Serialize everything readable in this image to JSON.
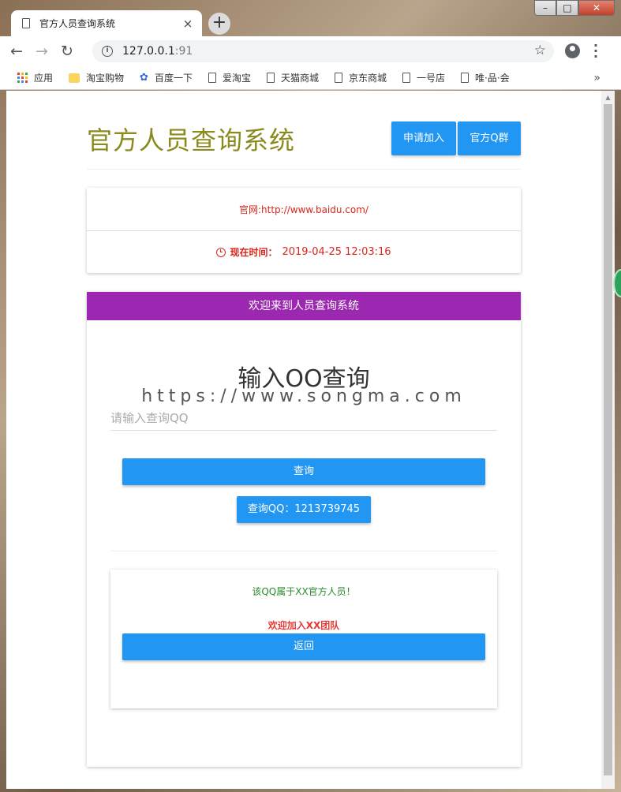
{
  "browser": {
    "tab_title": "官方人员查询系统",
    "tab_close": "×",
    "new_tab": "+",
    "url_host": "127.0.0.1",
    "url_port": ":91",
    "bookmarks": [
      "应用",
      "淘宝购物",
      "百度一下",
      "爱淘宝",
      "天猫商城",
      "京东商城",
      "一号店",
      "唯·品·会"
    ],
    "bookmarks_more": "»"
  },
  "header": {
    "site_title": "官方人员查询系统",
    "join_button": "申请加入",
    "qgroup_button": "官方Q群"
  },
  "info": {
    "website": "官网:http://www.baidu.com/",
    "time_label": "现在时间：",
    "time_value": "2019-04-25 12:03:16"
  },
  "panel": {
    "heading": "欢迎来到人员查询系统",
    "query_title": "输入OO查询",
    "watermark": "https://www.songma.com",
    "input_placeholder": "请输入查询QQ",
    "input_value": "",
    "search_button": "查询",
    "qq_button": "查询QQ：1213739745"
  },
  "result": {
    "message": "该QQ属于XX官方人员！",
    "welcome": "欢迎加入XX团队",
    "back_button": "返回"
  },
  "colors": {
    "accent_blue": "#2196f3",
    "panel_purple": "#9c27b0",
    "title_olive": "#8a8a1f",
    "alert_red": "#d9261c",
    "success_green": "#2a8a2a"
  }
}
